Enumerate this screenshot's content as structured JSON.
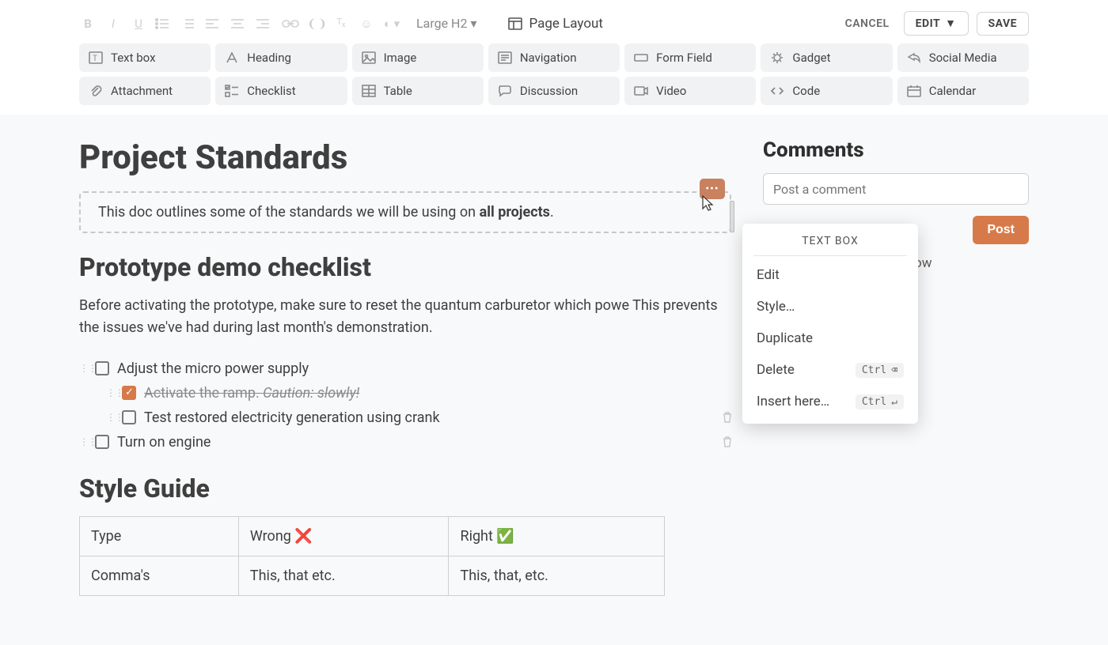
{
  "toolbar": {
    "heading_dropdown": "Large H2",
    "page_layout_label": "Page Layout",
    "cancel_label": "CANCEL",
    "edit_label": "EDIT",
    "save_label": "SAVE"
  },
  "insert_tiles": [
    {
      "icon": "textbox-icon",
      "label": "Text box"
    },
    {
      "icon": "heading-icon",
      "label": "Heading"
    },
    {
      "icon": "image-icon",
      "label": "Image"
    },
    {
      "icon": "navigation-icon",
      "label": "Navigation"
    },
    {
      "icon": "formfield-icon",
      "label": "Form Field"
    },
    {
      "icon": "gadget-icon",
      "label": "Gadget"
    },
    {
      "icon": "socialmedia-icon",
      "label": "Social Media"
    },
    {
      "icon": "attachment-icon",
      "label": "Attachment"
    },
    {
      "icon": "checklist-icon",
      "label": "Checklist"
    },
    {
      "icon": "table-icon",
      "label": "Table"
    },
    {
      "icon": "discussion-icon",
      "label": "Discussion"
    },
    {
      "icon": "video-icon",
      "label": "Video"
    },
    {
      "icon": "code-icon",
      "label": "Code"
    },
    {
      "icon": "calendar-icon",
      "label": "Calendar"
    }
  ],
  "doc": {
    "title": "Project Standards",
    "intro_prefix": "This doc outlines some of the standards we will be using on ",
    "intro_bold": "all projects",
    "intro_suffix": ".",
    "sub1": "Prototype demo checklist",
    "body1": "Before activating the prototype, make sure to reset the quantum carburetor which powe This prevents the issues we've had during last month's demonstration.",
    "checklist": [
      {
        "checked": false,
        "indent": 0,
        "text": "Adjust the micro power supply",
        "trash": false
      },
      {
        "checked": true,
        "indent": 1,
        "text_plain": "Activate the ramp. ",
        "text_caution": "Caution: slowly!",
        "trash": false
      },
      {
        "checked": false,
        "indent": 1,
        "text": "Test restored electricity generation using crank",
        "trash": true
      },
      {
        "checked": false,
        "indent": 0,
        "text": "Turn on engine",
        "trash": true
      }
    ],
    "sub2": "Style Guide",
    "table": {
      "headers": {
        "col1": "Type",
        "col2_text": "Wrong ",
        "col2_emoji": "❌",
        "col3_text": "Right ",
        "col3_emoji": "✅"
      },
      "rows": [
        {
          "col1": "Comma's",
          "col2": "This, that etc.",
          "col3": "This, that, etc."
        }
      ]
    }
  },
  "context_menu": {
    "title": "TEXT BOX",
    "items": {
      "edit": "Edit",
      "style": "Style…",
      "duplicate": "Duplicate",
      "delete": "Delete",
      "insert": "Insert here…"
    },
    "kbd": {
      "ctrl": "Ctrl",
      "backspace": "⌫",
      "enter": "↵"
    }
  },
  "comments": {
    "title": "Comments",
    "placeholder": "Post a comment",
    "post_label": "Post",
    "hint_fragment": "e page, comments will show"
  },
  "colors": {
    "accent": "#d77a4a"
  }
}
